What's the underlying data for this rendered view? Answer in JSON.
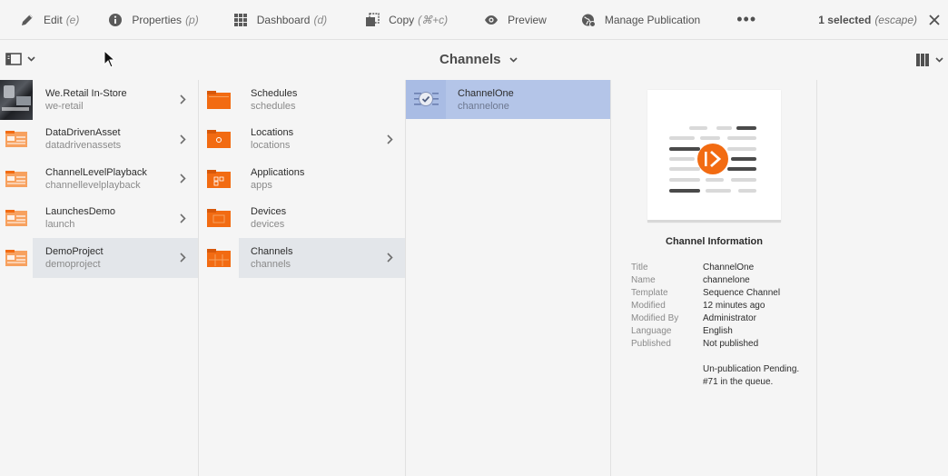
{
  "toolbar": {
    "edit": {
      "label": "Edit",
      "hint": "(e)"
    },
    "properties": {
      "label": "Properties",
      "hint": "(p)"
    },
    "dashboard": {
      "label": "Dashboard",
      "hint": "(d)"
    },
    "copy": {
      "label": "Copy",
      "hint": "(⌘+c)"
    },
    "preview": {
      "label": "Preview"
    },
    "manage_publication": {
      "label": "Manage Publication"
    },
    "more": "•••",
    "selected": "1 selected",
    "escape_hint": "(escape)"
  },
  "header": {
    "title": "Channels"
  },
  "column1": {
    "items": [
      {
        "title": "We.Retail In-Store",
        "name": "we-retail"
      },
      {
        "title": "DataDrivenAsset",
        "name": "datadrivenassets"
      },
      {
        "title": "ChannelLevelPlayback",
        "name": "channellevelplayback"
      },
      {
        "title": "LaunchesDemo",
        "name": "launch"
      },
      {
        "title": "DemoProject",
        "name": "demoproject"
      }
    ]
  },
  "column2": {
    "items": [
      {
        "title": "Schedules",
        "name": "schedules"
      },
      {
        "title": "Locations",
        "name": "locations"
      },
      {
        "title": "Applications",
        "name": "apps"
      },
      {
        "title": "Devices",
        "name": "devices"
      },
      {
        "title": "Channels",
        "name": "channels"
      }
    ]
  },
  "column3": {
    "items": [
      {
        "title": "ChannelOne",
        "name": "channelone"
      }
    ]
  },
  "info": {
    "heading": "Channel Information",
    "fields": [
      {
        "key": "Title",
        "value": "ChannelOne"
      },
      {
        "key": "Name",
        "value": "channelone"
      },
      {
        "key": "Template",
        "value": "Sequence Channel"
      },
      {
        "key": "Modified",
        "value": "12 minutes ago"
      },
      {
        "key": "Modified By",
        "value": "Administrator"
      },
      {
        "key": "Language",
        "value": "English"
      },
      {
        "key": "Published",
        "value": "Not published"
      }
    ],
    "pending_line1": "Un-publication Pending.",
    "pending_line2": "#71 in the queue."
  },
  "colors": {
    "accent_orange": "#f26b12",
    "selection_blue": "#b4c5e8",
    "row_highlight": "#e3e6ea"
  }
}
